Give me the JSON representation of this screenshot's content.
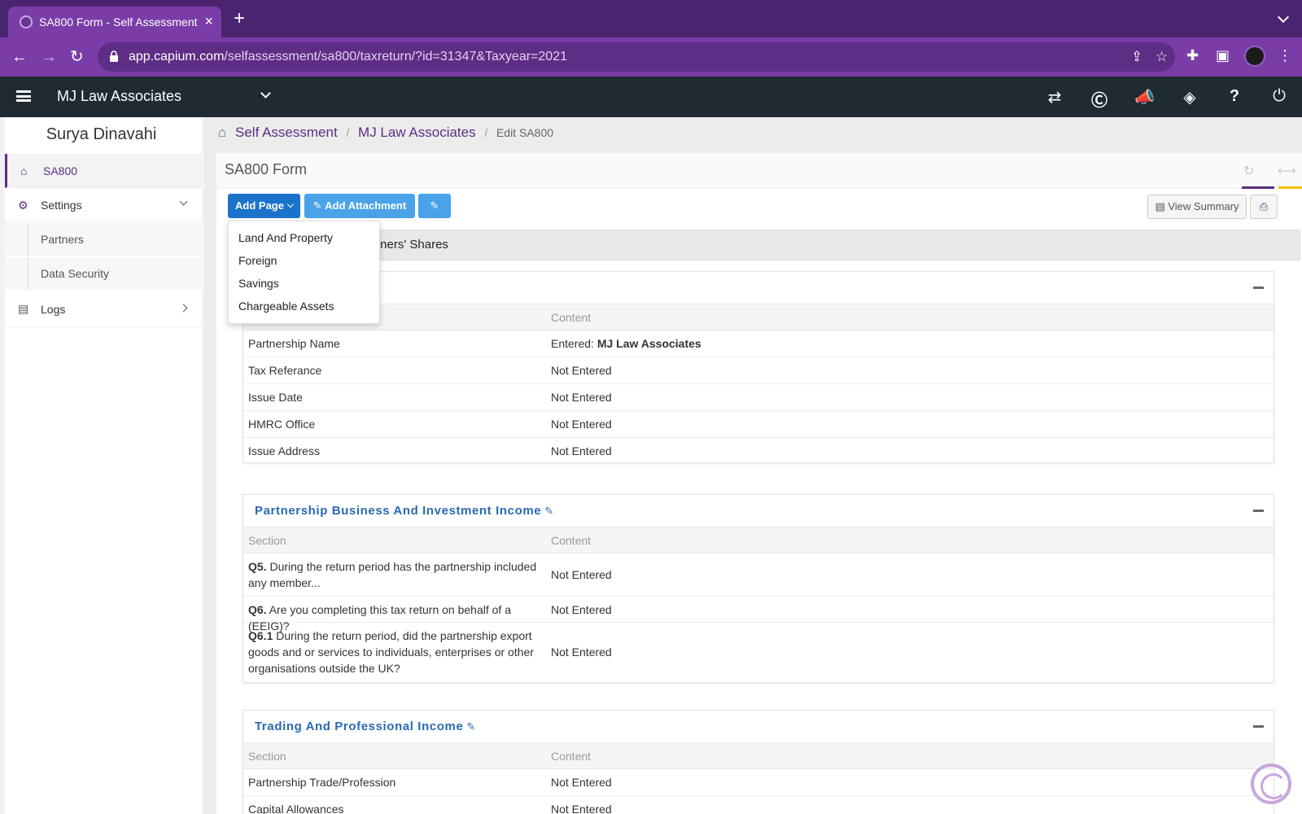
{
  "browser": {
    "tab_title": "SA800 Form - Self Assessment",
    "tab_close": "×",
    "new_tab": "+",
    "url_host": "app.capium.com",
    "url_path": "/selfassessment/sa800/taxreturn/?id=31347&Taxyear=2021"
  },
  "header": {
    "org_name": "MJ Law Associates",
    "icons": [
      "switch-icon",
      "capium-icon",
      "megaphone-icon",
      "ticket-icon",
      "help-icon",
      "power-icon"
    ]
  },
  "sidebar": {
    "user_name": "Surya Dinavahi",
    "items": [
      {
        "label": "SA800",
        "icon": "home-icon"
      },
      {
        "label": "Settings",
        "icon": "gear-icon"
      },
      {
        "label": "Partners"
      },
      {
        "label": "Data Security"
      },
      {
        "label": "Logs",
        "icon": "file-icon"
      }
    ]
  },
  "breadcrumb": {
    "items": [
      "Self Assessment",
      "MJ Law Associates"
    ],
    "current": "Edit SA800",
    "sep": "/"
  },
  "panel": {
    "title": "SA800 Form"
  },
  "toolbar": {
    "add_page": "Add Page",
    "add_attachment": "Add Attachment",
    "view_summary": "View Summary"
  },
  "tab_strip_label": "tners' Shares",
  "dropdown": {
    "items": [
      "Land And Property",
      "Foreign",
      "Savings",
      "Chargeable Assets"
    ]
  },
  "cards": {
    "partnership": {
      "header_content": "Content",
      "rows": [
        {
          "section": "Partnership Name",
          "prefix": "Entered: ",
          "value": "MJ Law Associates"
        },
        {
          "section": "Tax Referance",
          "value": "Not Entered"
        },
        {
          "section": "Issue Date",
          "value": "Not Entered"
        },
        {
          "section": "HMRC Office",
          "value": "Not Entered"
        },
        {
          "section": "Issue Address",
          "value": "Not Entered"
        }
      ]
    },
    "business": {
      "title": "Partnership Business And Investment Income",
      "header_section": "Section",
      "header_content": "Content",
      "rows": [
        {
          "q": "Q5.",
          "text": " During the return period has the partnership included any member...",
          "value": "Not Entered"
        },
        {
          "q": "Q6.",
          "text": " Are you completing this tax return on behalf of a (EEIG)?",
          "value": "Not Entered"
        },
        {
          "q": "Q6.1",
          "text": " During the return period, did the partnership export goods and or services to individuals, enterprises or other organisations outside the UK?",
          "value": "Not Entered"
        }
      ]
    },
    "trading": {
      "title": "Trading And Professional Income",
      "header_section": "Section",
      "header_content": "Content",
      "rows": [
        {
          "section": "Partnership Trade/Profession",
          "value": "Not Entered"
        },
        {
          "section": "Capital Allowances",
          "value": "Not Entered"
        }
      ]
    }
  }
}
